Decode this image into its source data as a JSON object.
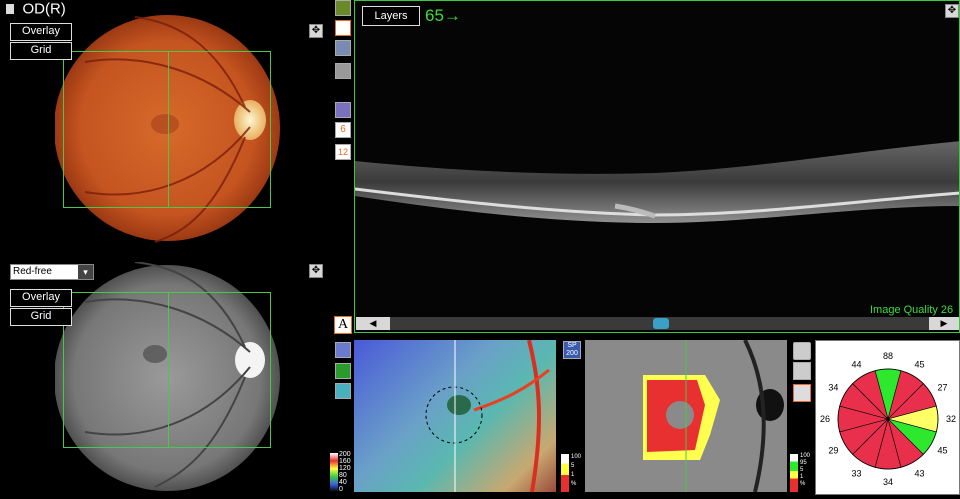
{
  "eye_label": "OD(R)",
  "fundus_top": {
    "overlay_label": "Overlay",
    "grid_label": "Grid"
  },
  "fundus_bottom": {
    "mode_select": "Red-free",
    "overlay_label": "Overlay",
    "grid_label": "Grid"
  },
  "bscan": {
    "layers_label": "Layers",
    "scan_number": "65→",
    "quality_label": "Image Quality 26"
  },
  "tools": {
    "btn6": "6",
    "btn12": "12",
    "text_tool": "A",
    "sp_badge": "SP\n200"
  },
  "thickness_scale": [
    "200",
    "160",
    "120",
    "80",
    "40",
    "0"
  ],
  "scale_percent_mid": [
    "100",
    "5",
    "1",
    "%"
  ],
  "scale_percent_right": [
    "100",
    "95",
    "5",
    "1",
    "%"
  ],
  "sectors": [
    {
      "value": "88",
      "color": "#2ee82e"
    },
    {
      "value": "45",
      "color": "#e8304c"
    },
    {
      "value": "27",
      "color": "#e8304c"
    },
    {
      "value": "32",
      "color": "#ffff66"
    },
    {
      "value": "45",
      "color": "#2ee82e"
    },
    {
      "value": "43",
      "color": "#e8304c"
    },
    {
      "value": "34",
      "color": "#e8304c"
    },
    {
      "value": "33",
      "color": "#e8304c"
    },
    {
      "value": "29",
      "color": "#e8304c"
    },
    {
      "value": "26",
      "color": "#e8304c"
    },
    {
      "value": "34",
      "color": "#e8304c"
    },
    {
      "value": "44",
      "color": "#e8304c"
    }
  ]
}
